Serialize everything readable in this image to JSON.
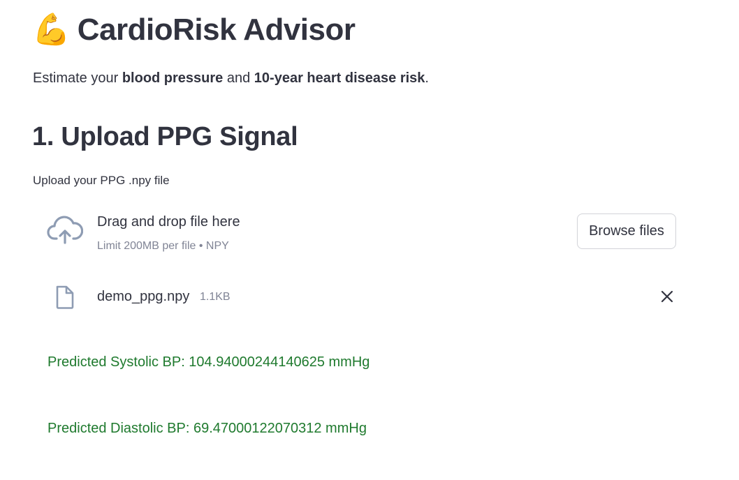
{
  "header": {
    "icon": "flexed-biceps-icon",
    "title": "CardioRisk Advisor"
  },
  "intro": {
    "part1": "Estimate your ",
    "bold1": "blood pressure",
    "part2": " and ",
    "bold2": "10-year heart disease risk",
    "part3": "."
  },
  "section": {
    "heading": "1. Upload PPG Signal",
    "upload_label": "Upload your PPG .npy file"
  },
  "dropzone": {
    "icon": "cloud-upload-icon",
    "title": "Drag and drop file here",
    "limit": "Limit 200MB per file • NPY",
    "browse_label": "Browse files"
  },
  "uploaded_file": {
    "icon": "file-icon",
    "name": "demo_ppg.npy",
    "size": "1.1KB",
    "remove_icon": "close-icon"
  },
  "results": {
    "systolic": "Predicted Systolic BP: 104.94000244140625 mmHg",
    "diastolic": "Predicted Diastolic BP: 69.47000122070312 mmHg"
  },
  "colors": {
    "text": "#31333f",
    "muted": "#808495",
    "success": "#1f7a2e",
    "icon": "#8e9cb3"
  }
}
